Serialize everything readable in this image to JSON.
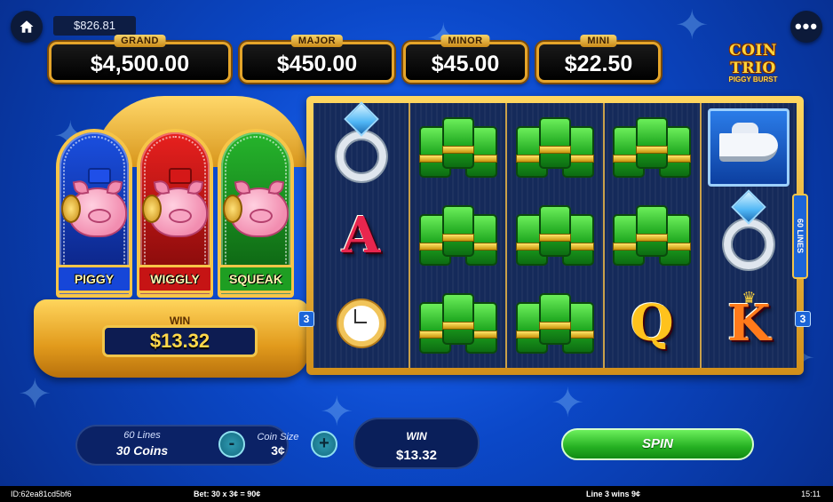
{
  "balance": "$826.81",
  "jackpots": [
    {
      "label": "GRAND",
      "value": "$4,500.00"
    },
    {
      "label": "MAJOR",
      "value": "$450.00"
    },
    {
      "label": "MINOR",
      "value": "$45.00"
    },
    {
      "label": "MINI",
      "value": "$22.50"
    }
  ],
  "logo": {
    "line1": "COIN TRIO",
    "line2": "PIGGY BURST",
    "tm": "TM"
  },
  "piggies": [
    {
      "name": "PIGGY"
    },
    {
      "name": "WIGGLY"
    },
    {
      "name": "SQUEAK"
    }
  ],
  "stage_win": {
    "label": "WIN",
    "value": "$13.32"
  },
  "reels": {
    "line_tag_left": "3",
    "line_tag_right": "3",
    "lines_tag": "60 LINES",
    "symbols": [
      [
        "diamond-ring",
        "letter-A",
        "gold-watch"
      ],
      [
        "cash-stack",
        "cash-stack",
        "cash-stack"
      ],
      [
        "cash-stack",
        "cash-stack",
        "cash-stack"
      ],
      [
        "cash-stack",
        "cash-stack",
        "letter-Q"
      ],
      [
        "yacht",
        "diamond-ring",
        "letter-K"
      ]
    ],
    "letters": {
      "A": "A",
      "Q": "Q",
      "K": "K"
    }
  },
  "controls": {
    "lines_label": "60 Lines",
    "coins_value": "30 Coins",
    "coin_size_label": "Coin Size",
    "coin_size_value": "3¢",
    "minus": "-",
    "plus": "+",
    "win_label": "WIN",
    "win_value": "$13.32",
    "spin_label": "SPIN"
  },
  "footer": {
    "id": "ID:62ea81cd5bf6",
    "bet": "Bet: 30 x 3¢ = 90¢",
    "line_win": "Line 3 wins 9¢",
    "time": "15:11"
  },
  "colors": {
    "background": "#0b48c8",
    "gold": "#f2c64a",
    "spin_green": "#25b022"
  }
}
